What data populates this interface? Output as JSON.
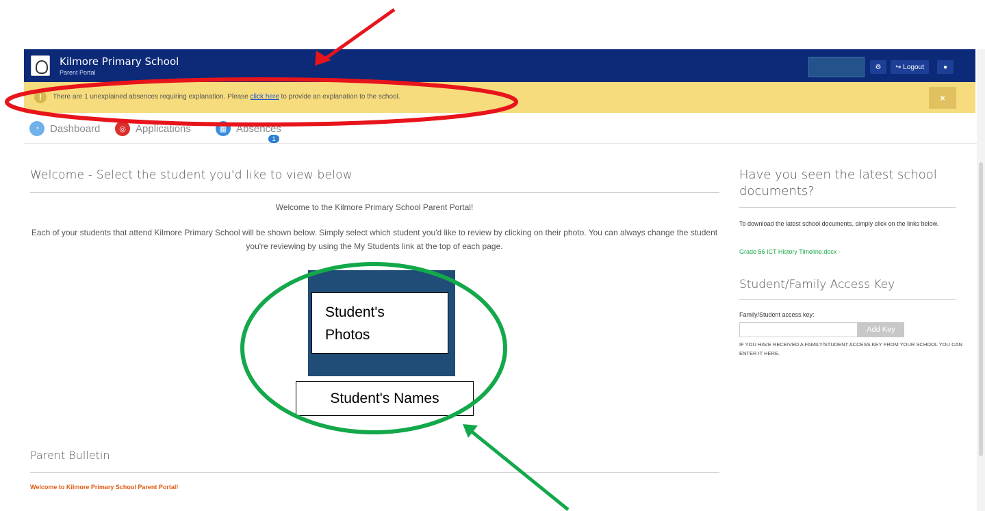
{
  "header": {
    "school_name": "Kilmore Primary School",
    "portal_label": "Parent Portal",
    "settings_icon": "gear-icon",
    "logout_label": "↪ Logout",
    "info_icon": "info-icon",
    "brand_color": "#0c2a78"
  },
  "alert": {
    "text_before": "There are 1 unexplained absences requiring explanation. Please ",
    "link_text": "click here",
    "text_after": " to provide an explanation to the school.",
    "close_label": "×",
    "color": "#f6dc7d"
  },
  "nav": {
    "items": [
      {
        "label": "Dashboard",
        "icon": "dashboard-icon",
        "color": "#6fb1ea"
      },
      {
        "label": "Applications",
        "icon": "applications-icon",
        "color": "#d9302b"
      },
      {
        "label": "Absences",
        "icon": "absences-icon",
        "color": "#3b8de0"
      }
    ],
    "badge": "1"
  },
  "main": {
    "title": "Welcome - Select the student you'd like to view below",
    "intro": "Welcome to the Kilmore Primary School Parent Portal!",
    "description": "Each of your students that attend Kilmore Primary School will be shown below. Simply select which student you'd like to review by clicking on their photo. You can always change the student you're reviewing by using the My Students link at the top of each page.",
    "photo_label_line1": "Student's",
    "photo_label_line2": "Photos",
    "name_label": "Student's Names"
  },
  "bulletin": {
    "title": "Parent Bulletin",
    "message": "Welcome to Kilmore Primary School Parent Portal!"
  },
  "sidebar": {
    "docs_title": "Have you seen the latest school documents?",
    "docs_text": "To download the latest school documents, simply click on the links below.",
    "doc_link": "Grade 56 ICT History Timeline.docx -",
    "key_title": "Student/Family Access Key",
    "key_label": "Family/Student access key:",
    "key_button": "Add Key",
    "key_help": "IF YOU HAVE RECEIVED A FAMILY/STUDENT ACCESS KEY FROM YOUR SCHOOL YOU CAN ENTER IT HERE."
  }
}
